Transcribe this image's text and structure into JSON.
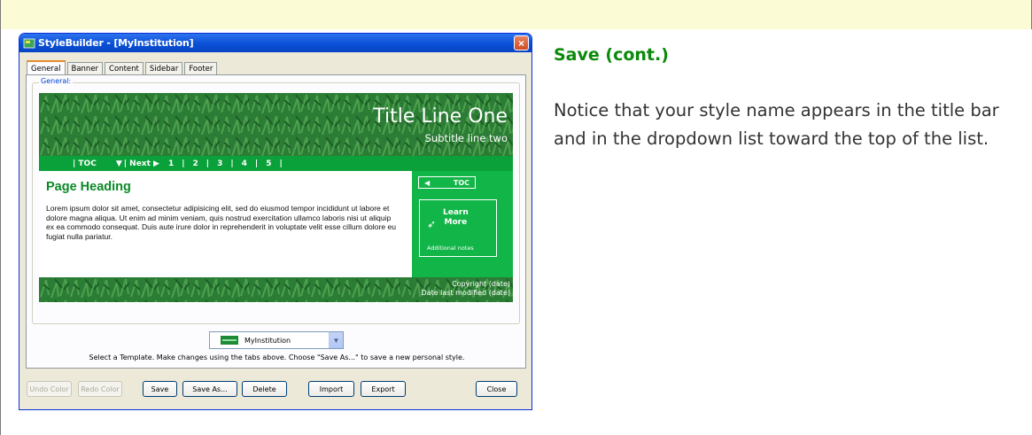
{
  "window": {
    "title": "StyleBuilder - [MyInstitution]",
    "close_glyph": "×",
    "tabs": [
      "General",
      "Banner",
      "Content",
      "Sidebar",
      "Footer"
    ],
    "active_tab": "General",
    "group_label": "General:"
  },
  "preview": {
    "title_line_one": "Title Line One",
    "subtitle": "Subtitle line two",
    "nav": {
      "toc": "| TOC",
      "toc_arrow": "▼",
      "next": "| Next ▶",
      "pages": [
        "1",
        "2",
        "3",
        "4",
        "5"
      ]
    },
    "page_heading": "Page Heading",
    "body_text": "Lorem ipsum dolor sit amet, consectetur adipisicing elit, sed do eiusmod tempor incididunt ut labore et dolore magna aliqua. Ut enim ad minim veniam, quis nostrud exercitation ullamco laboris nisi ut aliquip ex ea commodo consequat. Duis aute irure dolor in reprehenderit in voluptate velit esse cillum dolore eu fugiat nulla pariatur.",
    "sidebar": {
      "toc_arrow": "◀",
      "toc_label": "TOC",
      "learn_line1": "Learn",
      "learn_line2": "More",
      "additional_notes": "Additional notes"
    },
    "footer": {
      "copyright": "Copyright (date)",
      "modified": "Date last modified (date)"
    },
    "colors": {
      "banner_green": "#1f7a2c",
      "nav_green": "#0aa03a",
      "sidebar_green": "#12b547",
      "heading_green": "#0a8a26"
    }
  },
  "template_select": {
    "selected": "MyInstitution"
  },
  "instruction": "Select a Template. Make changes using the tabs above. Choose \"Save As...\" to save a new personal style.",
  "buttons": {
    "undo_color": "Undo Color",
    "redo_color": "Redo Color",
    "save": "Save",
    "save_as": "Save As...",
    "delete": "Delete",
    "import": "Import",
    "export": "Export",
    "close": "Close"
  },
  "slide": {
    "heading": "Save (cont.)",
    "body": "Notice that your style name appears in the title bar and in the dropdown list toward the top of the list."
  }
}
